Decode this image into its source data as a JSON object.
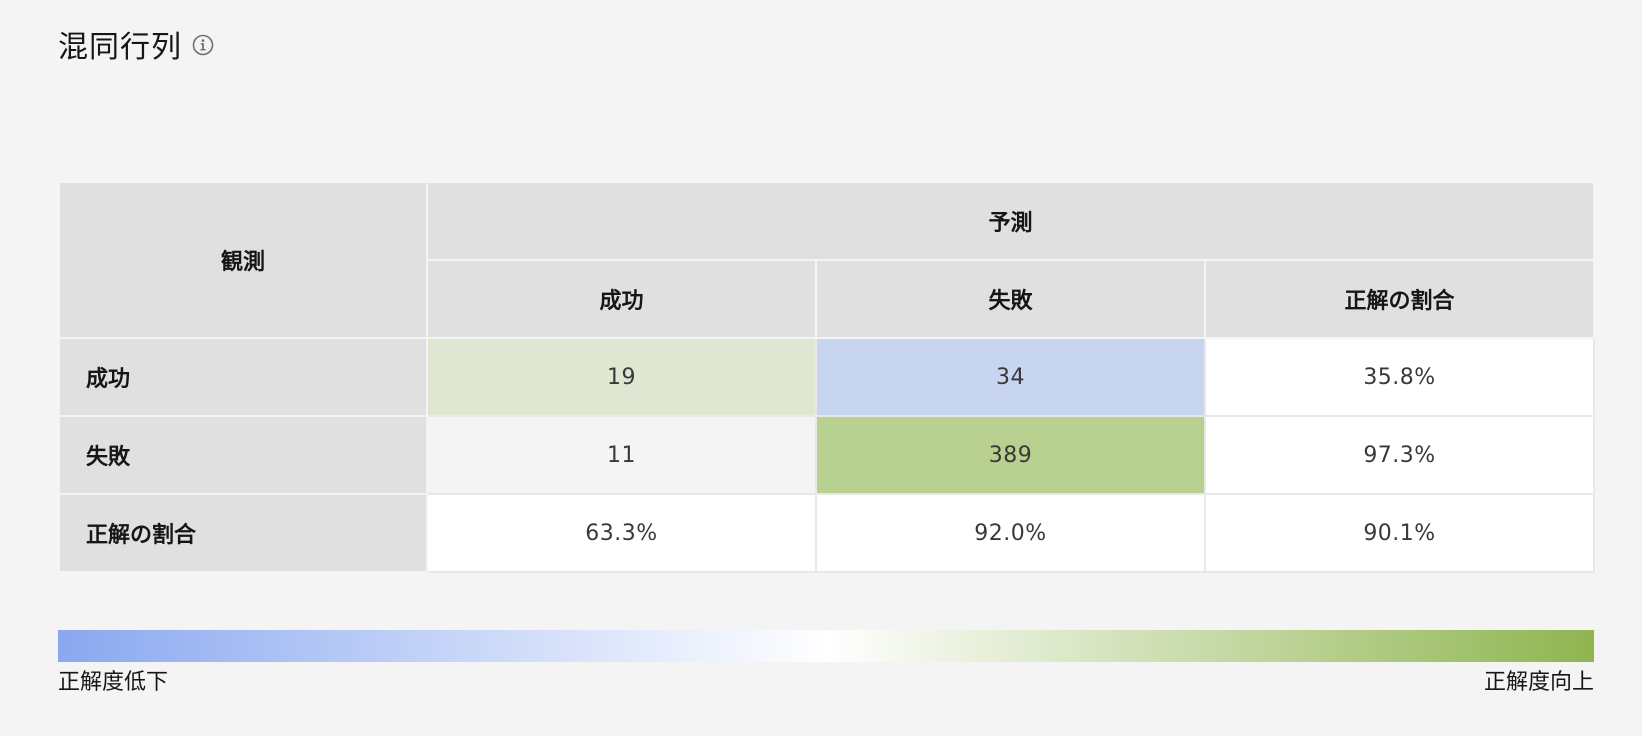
{
  "title": "混同行列",
  "icons": {
    "info": "info-circle-icon"
  },
  "chart_data": {
    "type": "table",
    "corner_label": "観測",
    "predicted_label": "予測",
    "columns": [
      "成功",
      "失敗",
      "正解の割合"
    ],
    "rows": [
      {
        "label": "成功",
        "cells": [
          "19",
          "34",
          "35.8%"
        ]
      },
      {
        "label": "失敗",
        "cells": [
          "11",
          "389",
          "97.3%"
        ]
      },
      {
        "label": "正解の割合",
        "cells": [
          "63.3%",
          "92.0%",
          "90.1%"
        ]
      }
    ],
    "cell_colors": [
      [
        "#dfe6d1",
        "#c7d5f1",
        "#ffffff"
      ],
      [
        "#f4f4f4",
        "#b8d090",
        "#ffffff"
      ],
      [
        "#ffffff",
        "#ffffff",
        "#ffffff"
      ]
    ],
    "legend": {
      "low_label": "正解度低下",
      "high_label": "正解度向上",
      "low_color": "#8aa8f0",
      "mid_color": "#ffffff",
      "high_color": "#8fb550"
    }
  }
}
